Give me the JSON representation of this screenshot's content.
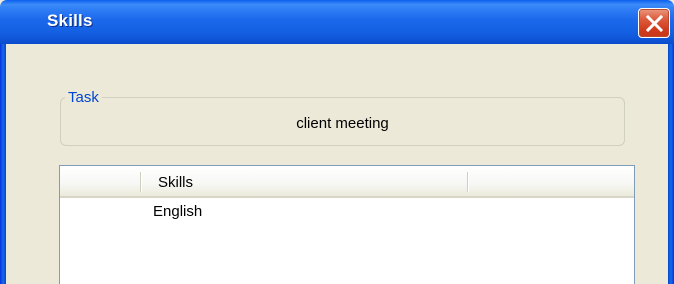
{
  "window": {
    "title": "Skills",
    "close_icon": "close-x-icon"
  },
  "task_group": {
    "legend": "Task",
    "value": "client meeting"
  },
  "skills_list": {
    "columns": [
      "",
      "Skills",
      ""
    ],
    "rows": [
      {
        "skill": "English"
      }
    ]
  },
  "colors": {
    "titlebar": "#1C68EC",
    "window_body": "#ECE9D8",
    "groupbox_legend": "#0046D5",
    "close_button": "#D54A2A"
  }
}
